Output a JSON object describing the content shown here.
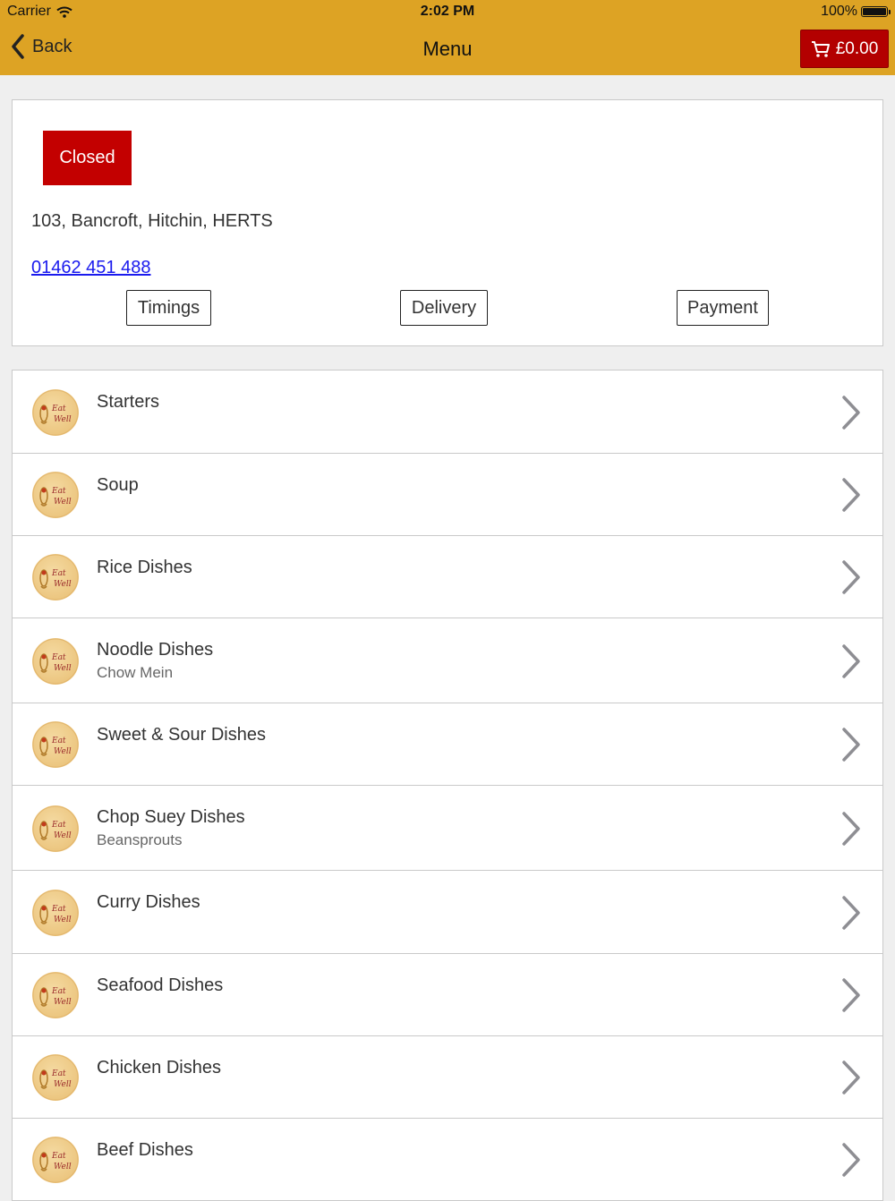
{
  "status_bar": {
    "carrier": "Carrier",
    "time": "2:02 PM",
    "battery": "100%"
  },
  "nav": {
    "back_label": "Back",
    "title": "Menu",
    "cart_total": "£0.00"
  },
  "store": {
    "status": "Closed",
    "address": "103, Bancroft, Hitchin, HERTS",
    "phone": "01462 451 488",
    "buttons": {
      "timings": "Timings",
      "delivery": "Delivery",
      "payment": "Payment"
    }
  },
  "categories": [
    {
      "title": "Starters",
      "subtitle": ""
    },
    {
      "title": "Soup",
      "subtitle": ""
    },
    {
      "title": "Rice Dishes",
      "subtitle": ""
    },
    {
      "title": "Noodle Dishes",
      "subtitle": "Chow Mein"
    },
    {
      "title": "Sweet & Sour Dishes",
      "subtitle": ""
    },
    {
      "title": "Chop Suey Dishes",
      "subtitle": "Beansprouts"
    },
    {
      "title": "Curry Dishes",
      "subtitle": ""
    },
    {
      "title": "Seafood Dishes",
      "subtitle": ""
    },
    {
      "title": "Chicken Dishes",
      "subtitle": ""
    },
    {
      "title": "Beef Dishes",
      "subtitle": ""
    }
  ],
  "colors": {
    "nav_bar": "#dda324",
    "accent_red": "#c30000",
    "link_blue": "#1a1aee"
  },
  "icons": [
    "wifi-icon",
    "battery-icon",
    "back-chevron-icon",
    "cart-icon",
    "restaurant-logo-icon",
    "chevron-right-icon"
  ]
}
